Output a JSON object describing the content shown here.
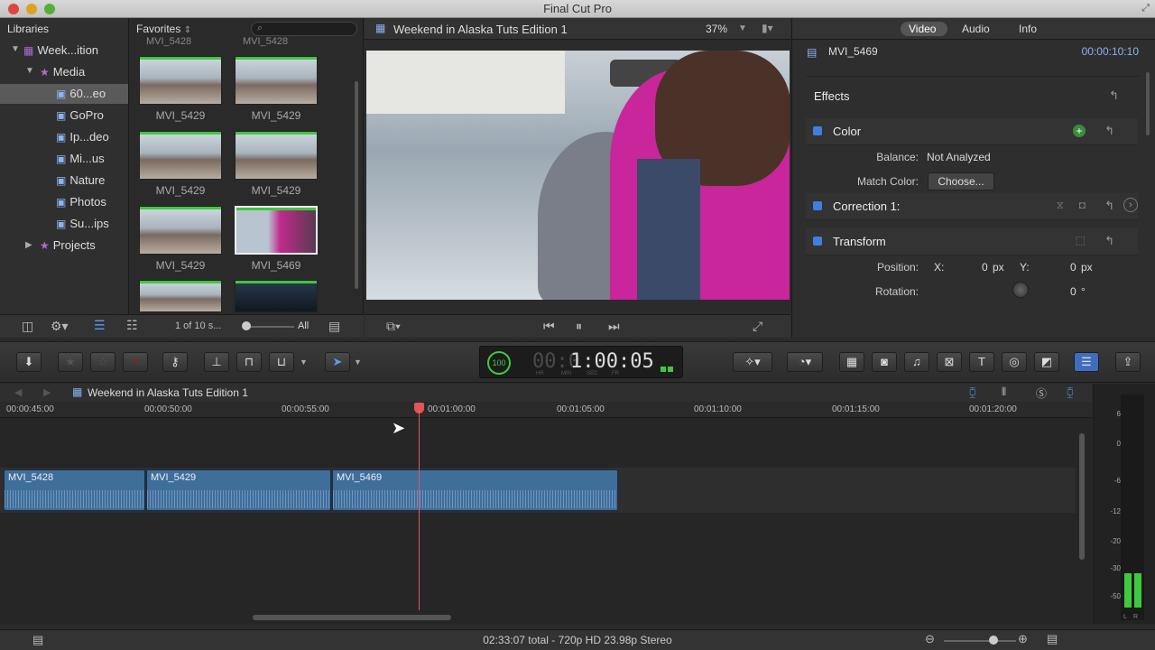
{
  "window": {
    "title": "Final Cut Pro"
  },
  "browser": {
    "libraries_label": "Libraries",
    "favorites_label": "Favorites",
    "search_placeholder": "",
    "library_name": "Week...ition",
    "media_label": "Media",
    "events": [
      "60...eo",
      "GoPro",
      "Ip...deo",
      "Mi...us",
      "Nature",
      "Photos",
      "Su...ips"
    ],
    "projects_label": "Projects",
    "clip_top_labels": [
      "MVI_5428",
      "MVI_5428"
    ],
    "clips": [
      {
        "label": "MVI_5429"
      },
      {
        "label": "MVI_5429"
      },
      {
        "label": "MVI_5429"
      },
      {
        "label": "MVI_5429"
      },
      {
        "label": "MVI_5429"
      },
      {
        "label": "MVI_5469"
      }
    ],
    "count_label": "1 of 10 s...",
    "filter_label": "All"
  },
  "viewer": {
    "title": "Weekend in Alaska Tuts Edition 1",
    "zoom": "37%"
  },
  "inspector": {
    "tabs": [
      "Video",
      "Audio",
      "Info"
    ],
    "clip_name": "MVI_5469",
    "timecode": "00:00:10:10",
    "effects_label": "Effects",
    "color_label": "Color",
    "balance_label": "Balance:",
    "balance_value": "Not Analyzed",
    "match_color_label": "Match Color:",
    "match_color_button": "Choose...",
    "correction_label": "Correction 1:",
    "transform_label": "Transform",
    "position_label": "Position:",
    "x_label": "X:",
    "x_value": "0",
    "y_label": "Y:",
    "y_value": "0",
    "px_unit": "px",
    "rotation_label": "Rotation:",
    "rotation_value": "0",
    "deg_unit": "°"
  },
  "toolbar": {
    "timecode": "1:00:05",
    "timecode_prefix": "00:0",
    "dial_value": "100",
    "tc_units": [
      "HR",
      "MIN",
      "SEC",
      "FR"
    ]
  },
  "timeline": {
    "project_name": "Weekend in Alaska Tuts Edition 1",
    "ruler": [
      "00:00:45:00",
      "00:00:50:00",
      "00:00:55:00",
      "00:01:00:00",
      "00:01:05:00",
      "00:01:10:00",
      "00:01:15:00",
      "00:01:20:00"
    ],
    "clips": [
      "MVI_5428",
      "MVI_5429",
      "MVI_5469"
    ],
    "meter_labels": [
      "6",
      "0",
      "-6",
      "-12",
      "-20",
      "-30",
      "-50"
    ],
    "meter_lr": [
      "L",
      "R"
    ]
  },
  "statusbar": {
    "text": "02:33:07 total - 720p HD 23.98p Stereo"
  },
  "colors": {
    "accent": "#3f7fe0",
    "playhead": "#e05555",
    "clip": "#3f6e9a",
    "purple": "#b06bd0"
  }
}
